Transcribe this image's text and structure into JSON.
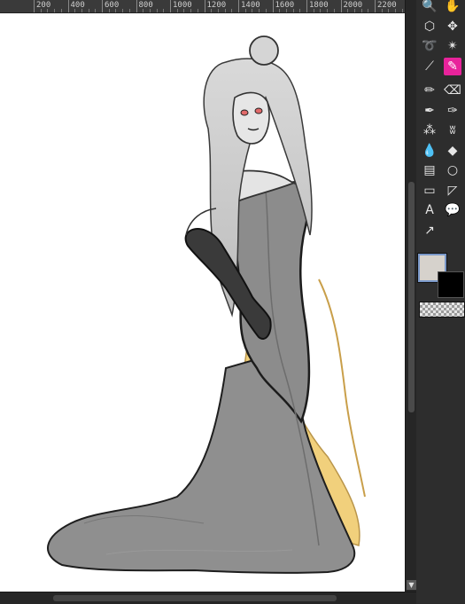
{
  "ruler": {
    "labels": [
      "200",
      "400",
      "600",
      "800",
      "1000",
      "1200",
      "1400",
      "1600",
      "1800",
      "2000",
      "2200"
    ]
  },
  "toolbox": {
    "tools": [
      {
        "name": "zoom-tool",
        "icon": "magnifier-icon",
        "glyph": "🔍",
        "active": false
      },
      {
        "name": "pan-tool",
        "icon": "hand-icon",
        "glyph": "✋",
        "active": false
      },
      {
        "name": "unified-transform-tool",
        "icon": "transform-icon",
        "glyph": "⬡",
        "active": false
      },
      {
        "name": "move-tool",
        "icon": "move-icon",
        "glyph": "✥",
        "active": false
      },
      {
        "name": "free-select-tool",
        "icon": "lasso-icon",
        "glyph": "➰",
        "active": false
      },
      {
        "name": "fuzzy-select-tool",
        "icon": "magic-wand-icon",
        "glyph": "✴",
        "active": false
      },
      {
        "name": "color-picker-tool",
        "icon": "eyedropper-icon",
        "glyph": "⟋",
        "active": false
      },
      {
        "name": "paintbrush-tool",
        "icon": "paintbrush-icon",
        "glyph": "✎",
        "active": true
      },
      {
        "name": "pencil-tool",
        "icon": "pencil-icon",
        "glyph": "✏",
        "active": false
      },
      {
        "name": "eraser-tool",
        "icon": "eraser-icon",
        "glyph": "⌫",
        "active": false
      },
      {
        "name": "mypaint-brush-tool",
        "icon": "ink-pen-icon",
        "glyph": "✒",
        "active": false
      },
      {
        "name": "ink-tool",
        "icon": "ink-icon",
        "glyph": "✑",
        "active": false
      },
      {
        "name": "airbrush-tool",
        "icon": "airbrush-icon",
        "glyph": "⁂",
        "active": false
      },
      {
        "name": "smudge-tool",
        "icon": "smudge-icon",
        "glyph": "ʬ",
        "active": false
      },
      {
        "name": "blur-tool",
        "icon": "water-drop-icon",
        "glyph": "💧",
        "active": false
      },
      {
        "name": "bucket-fill-tool",
        "icon": "bucket-icon",
        "glyph": "◆",
        "active": false
      },
      {
        "name": "gradient-tool",
        "icon": "gradient-icon",
        "glyph": "▤",
        "active": false
      },
      {
        "name": "ellipse-select-tool",
        "icon": "ellipse-icon",
        "glyph": "○",
        "active": false
      },
      {
        "name": "rect-select-tool",
        "icon": "rectangle-icon",
        "glyph": "▭",
        "active": false
      },
      {
        "name": "perspective-tool",
        "icon": "perspective-icon",
        "glyph": "◸",
        "active": false
      },
      {
        "name": "text-tool",
        "icon": "text-icon",
        "glyph": "A",
        "active": false
      },
      {
        "name": "warp-transform-tool",
        "icon": "speech-bubble-icon",
        "glyph": "💬",
        "active": false
      },
      {
        "name": "paths-tool",
        "icon": "pen-nib-icon",
        "glyph": "↗",
        "active": false
      }
    ]
  },
  "colors": {
    "foreground": "#d6d2cc",
    "background": "#000000",
    "active_tool": "#e8239b",
    "canvas": "#ffffff",
    "dress": "#8a8a8a",
    "underlay": "#f0c868"
  }
}
